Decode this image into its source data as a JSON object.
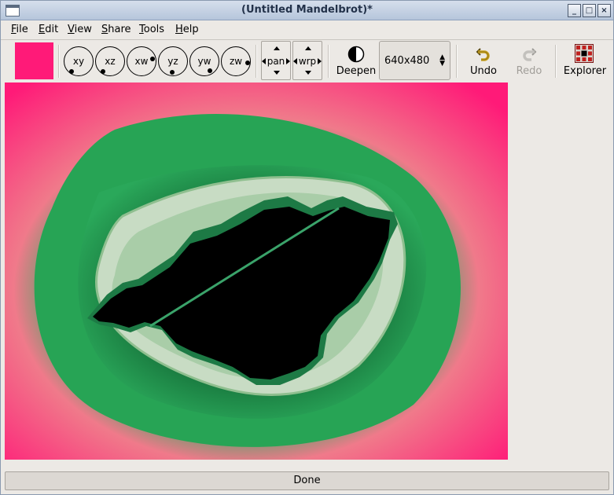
{
  "window": {
    "title": "(Untitled Mandelbrot)*",
    "controls": {
      "minimize": "_",
      "maximize": "□",
      "close": "×"
    }
  },
  "menubar": {
    "items": [
      {
        "label": "File",
        "mnemonic": "F",
        "rest": "ile"
      },
      {
        "label": "Edit",
        "mnemonic": "E",
        "rest": "dit"
      },
      {
        "label": "View",
        "mnemonic": "V",
        "rest": "iew"
      },
      {
        "label": "Share",
        "mnemonic": "S",
        "rest": "hare"
      },
      {
        "label": "Tools",
        "mnemonic": "T",
        "rest": "ools"
      },
      {
        "label": "Help",
        "mnemonic": "H",
        "rest": "elp"
      }
    ]
  },
  "toolbar": {
    "color_swatch": "#ff1a78",
    "axes": [
      "xy",
      "xz",
      "xw",
      "yz",
      "yw",
      "zw"
    ],
    "pan_label": "pan",
    "warp_label": "wrp",
    "deepen_label": "Deepen",
    "size_value": "640x480",
    "undo_label": "Undo",
    "redo_label": "Redo",
    "explorer_label": "Explorer"
  },
  "status": {
    "text": "Done"
  },
  "colors": {
    "outer": "#ff1a78",
    "mid": "#2aa85a",
    "inner": "#c8dcc4",
    "set": "#000000"
  }
}
